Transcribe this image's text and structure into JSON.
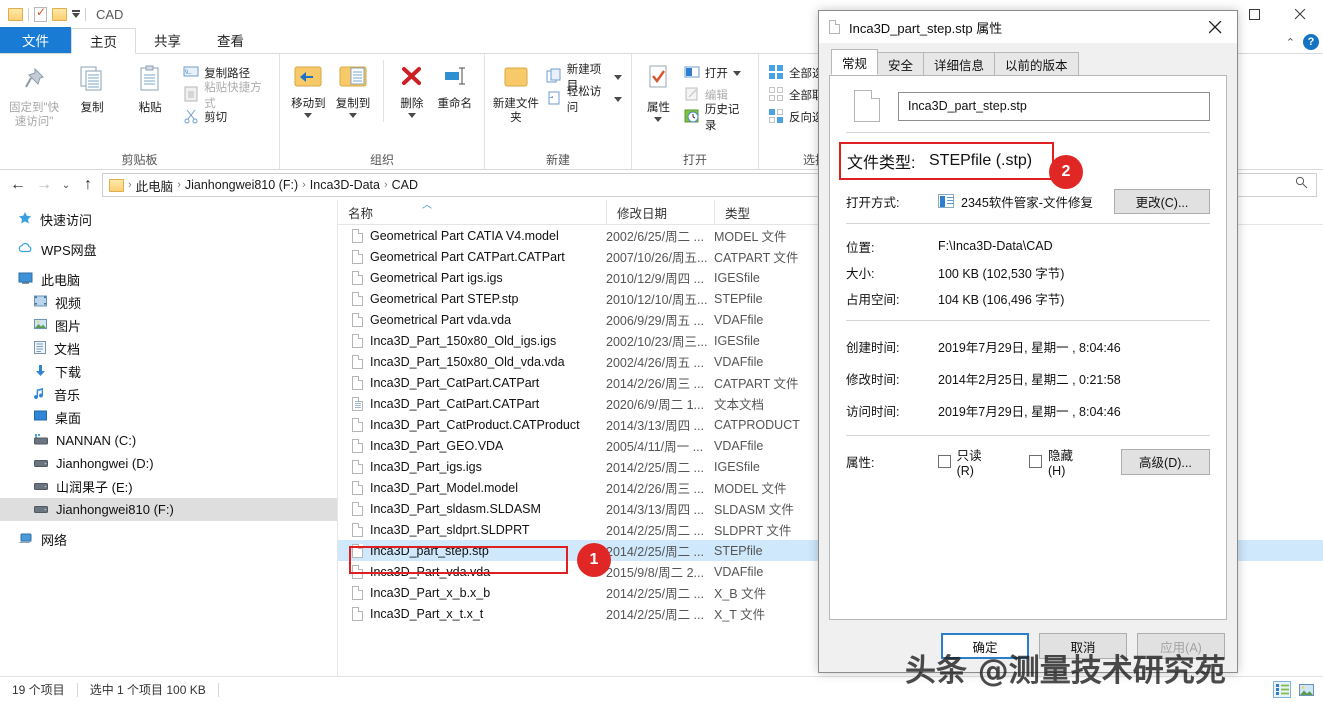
{
  "window": {
    "title": "CAD",
    "controls": {
      "minimize": "–",
      "maximize": "□",
      "close": "✕",
      "collapse_ribbon": "⌃",
      "help": "?"
    }
  },
  "ribbon_tabs": [
    {
      "label": "文件",
      "name": "tab-file"
    },
    {
      "label": "主页",
      "name": "tab-home"
    },
    {
      "label": "共享",
      "name": "tab-share"
    },
    {
      "label": "查看",
      "name": "tab-view"
    }
  ],
  "ribbon": {
    "groups": [
      {
        "label": "剪贴板",
        "big": [
          {
            "label": "固定到\"快速访问\"",
            "icon": "pin-icon",
            "dim": true
          },
          {
            "label": "复制",
            "icon": "copy-icon",
            "dim": false
          },
          {
            "label": "粘贴",
            "icon": "paste-icon",
            "dim": false
          }
        ],
        "small": [
          {
            "label": "复制路径",
            "icon": "copy-path-icon",
            "dim": false
          },
          {
            "label": "粘贴快捷方式",
            "icon": "paste-shortcut-icon",
            "dim": true
          },
          {
            "label": "剪切",
            "icon": "cut-icon",
            "dim": false
          }
        ]
      },
      {
        "label": "组织",
        "big": [
          {
            "label": "移动到",
            "icon": "move-to-icon",
            "dropdown": true
          },
          {
            "label": "复制到",
            "icon": "copy-to-icon",
            "dropdown": true
          },
          {
            "label": "删除",
            "icon": "delete-icon",
            "dropdown": true
          },
          {
            "label": "重命名",
            "icon": "rename-icon",
            "dropdown": false
          }
        ],
        "small": []
      },
      {
        "label": "新建",
        "big": [
          {
            "label": "新建文件夹",
            "icon": "new-folder-icon"
          }
        ],
        "small": [
          {
            "label": "新建项目",
            "icon": "new-item-icon",
            "dropdown": true
          },
          {
            "label": "轻松访问",
            "icon": "easy-access-icon",
            "dropdown": true
          }
        ]
      },
      {
        "label": "打开",
        "big": [
          {
            "label": "属性",
            "icon": "properties-icon",
            "dropdown": true
          }
        ],
        "small": [
          {
            "label": "打开",
            "icon": "open-icon",
            "dropdown": true
          },
          {
            "label": "编辑",
            "icon": "edit-icon",
            "dim": true
          },
          {
            "label": "历史记录",
            "icon": "history-icon"
          }
        ]
      },
      {
        "label": "选择",
        "big": [],
        "small": [
          {
            "label": "全部选择",
            "icon": "select-all-icon"
          },
          {
            "label": "全部取消",
            "icon": "select-none-icon"
          },
          {
            "label": "反向选择",
            "icon": "invert-selection-icon"
          }
        ]
      }
    ]
  },
  "address_bar": {
    "back": "←",
    "forward": "→",
    "recent": "⌄",
    "up": "↑",
    "crumbs": [
      "此电脑",
      "Jianhongwei810 (F:)",
      "Inca3D-Data",
      "CAD"
    ],
    "separator": "›",
    "search_icon": "search-icon"
  },
  "nav_pane": {
    "items": [
      {
        "label": "快速访问",
        "icon": "star-icon",
        "indent": false,
        "selected": false
      },
      {
        "label": "WPS网盘",
        "icon": "cloud-icon",
        "indent": false,
        "selected": false
      },
      {
        "label": "此电脑",
        "icon": "computer-icon",
        "indent": false,
        "selected": false
      },
      {
        "label": "视频",
        "icon": "video-icon",
        "indent": true,
        "selected": false
      },
      {
        "label": "图片",
        "icon": "pictures-icon",
        "indent": true,
        "selected": false
      },
      {
        "label": "文档",
        "icon": "documents-icon",
        "indent": true,
        "selected": false
      },
      {
        "label": "下载",
        "icon": "downloads-icon",
        "indent": true,
        "selected": false
      },
      {
        "label": "音乐",
        "icon": "music-icon",
        "indent": true,
        "selected": false
      },
      {
        "label": "桌面",
        "icon": "desktop-icon",
        "indent": true,
        "selected": false
      },
      {
        "label": "NANNAN (C:)",
        "icon": "system-drive-icon",
        "indent": true,
        "selected": false
      },
      {
        "label": "Jianhongwei (D:)",
        "icon": "drive-icon",
        "indent": true,
        "selected": false
      },
      {
        "label": "山润果子 (E:)",
        "icon": "drive-icon",
        "indent": true,
        "selected": false
      },
      {
        "label": "Jianhongwei810 (F:)",
        "icon": "drive-icon",
        "indent": true,
        "selected": true
      },
      {
        "label": "网络",
        "icon": "network-icon",
        "indent": false,
        "selected": false
      }
    ]
  },
  "file_list": {
    "columns": [
      "名称",
      "修改日期",
      "类型"
    ],
    "sorted_column_index": 0,
    "rows": [
      {
        "name": "Geometrical Part CATIA V4.model",
        "date": "2002/6/25/周二 ...",
        "type": "MODEL 文件",
        "icon": "file-icon",
        "selected": false
      },
      {
        "name": "Geometrical Part CATPart.CATPart",
        "date": "2007/10/26/周五...",
        "type": "CATPART 文件",
        "icon": "file-icon",
        "selected": false
      },
      {
        "name": "Geometrical Part igs.igs",
        "date": "2010/12/9/周四 ...",
        "type": "IGESfile",
        "icon": "file-icon",
        "selected": false
      },
      {
        "name": "Geometrical Part STEP.stp",
        "date": "2010/12/10/周五...",
        "type": "STEPfile",
        "icon": "file-icon",
        "selected": false
      },
      {
        "name": "Geometrical Part vda.vda",
        "date": "2006/9/29/周五 ...",
        "type": "VDAFfile",
        "icon": "file-icon",
        "selected": false
      },
      {
        "name": "Inca3D_Part_150x80_Old_igs.igs",
        "date": "2002/10/23/周三...",
        "type": "IGESfile",
        "icon": "file-icon",
        "selected": false
      },
      {
        "name": "Inca3D_Part_150x80_Old_vda.vda",
        "date": "2002/4/26/周五 ...",
        "type": "VDAFfile",
        "icon": "file-icon",
        "selected": false
      },
      {
        "name": "Inca3D_Part_CatPart.CATPart",
        "date": "2014/2/26/周三 ...",
        "type": "CATPART 文件",
        "icon": "file-icon",
        "selected": false
      },
      {
        "name": "Inca3D_Part_CatPart.CATPart",
        "date": "2020/6/9/周二 1...",
        "type": "文本文档",
        "icon": "text-file-icon",
        "selected": false
      },
      {
        "name": "Inca3D_Part_CatProduct.CATProduct",
        "date": "2014/3/13/周四 ...",
        "type": "CATPRODUCT",
        "icon": "file-icon",
        "selected": false
      },
      {
        "name": "Inca3D_Part_GEO.VDA",
        "date": "2005/4/11/周一 ...",
        "type": "VDAFfile",
        "icon": "file-icon",
        "selected": false
      },
      {
        "name": "Inca3D_Part_igs.igs",
        "date": "2014/2/25/周二 ...",
        "type": "IGESfile",
        "icon": "file-icon",
        "selected": false
      },
      {
        "name": "Inca3D_Part_Model.model",
        "date": "2014/2/26/周三 ...",
        "type": "MODEL 文件",
        "icon": "file-icon",
        "selected": false
      },
      {
        "name": "Inca3D_Part_sldasm.SLDASM",
        "date": "2014/3/13/周四 ...",
        "type": "SLDASM 文件",
        "icon": "file-icon",
        "selected": false
      },
      {
        "name": "Inca3D_Part_sldprt.SLDPRT",
        "date": "2014/2/25/周二 ...",
        "type": "SLDPRT 文件",
        "icon": "file-icon",
        "selected": false
      },
      {
        "name": "Inca3D_part_step.stp",
        "date": "2014/2/25/周二 ...",
        "type": "STEPfile",
        "icon": "file-icon",
        "selected": true
      },
      {
        "name": "Inca3D_Part_vda.vda",
        "date": "2015/9/8/周二 2...",
        "type": "VDAFfile",
        "icon": "file-icon",
        "selected": false
      },
      {
        "name": "Inca3D_Part_x_b.x_b",
        "date": "2014/2/25/周二 ...",
        "type": "X_B 文件",
        "icon": "file-icon",
        "selected": false
      },
      {
        "name": "Inca3D_Part_x_t.x_t",
        "date": "2014/2/25/周二 ...",
        "type": "X_T 文件",
        "icon": "file-icon",
        "selected": false
      }
    ]
  },
  "status_bar": {
    "item_count": "19 个项目",
    "selection": "选中 1 个项目  100 KB",
    "view_details_icon": "details-view-icon",
    "view_thumbnails_icon": "large-icons-view-icon"
  },
  "dialog": {
    "title": "Inca3D_part_step.stp 属性",
    "title_icon": "file-icon",
    "close": "✕",
    "tabs": [
      {
        "label": "常规",
        "active": true
      },
      {
        "label": "安全",
        "active": false
      },
      {
        "label": "详细信息",
        "active": false
      },
      {
        "label": "以前的版本",
        "active": false
      }
    ],
    "filename": "Inca3D_part_step.stp",
    "fields": {
      "file_type_label": "文件类型:",
      "file_type_value": "STEPfile (.stp)",
      "open_with_label": "打开方式:",
      "open_with_value": "2345软件管家-文件修复",
      "change_button": "更改(C)...",
      "location_label": "位置:",
      "location_value": "F:\\Inca3D-Data\\CAD",
      "size_label": "大小:",
      "size_value": "100 KB (102,530 字节)",
      "disk_size_label": "占用空间:",
      "disk_size_value": "104 KB (106,496 字节)",
      "created_label": "创建时间:",
      "created_value": "2019年7月29日, 星期一 , 8:04:46",
      "modified_label": "修改时间:",
      "modified_value": "2014年2月25日, 星期二 , 0:21:58",
      "accessed_label": "访问时间:",
      "accessed_value": "2019年7月29日, 星期一 , 8:04:46",
      "attributes_label": "属性:",
      "readonly_label": "只读(R)",
      "hidden_label": "隐藏(H)",
      "advanced_button": "高级(D)..."
    },
    "footer": {
      "ok": "确定",
      "cancel": "取消",
      "apply": "应用(A)"
    }
  },
  "callouts": [
    {
      "number": "1"
    },
    {
      "number": "2"
    }
  ],
  "watermark": "头条 @测量技术研究苑",
  "colors": {
    "accent": "#1a7bd4",
    "selection": "#cfe8fb",
    "callout_red": "#e02726",
    "highlight_box": "#e02020"
  }
}
